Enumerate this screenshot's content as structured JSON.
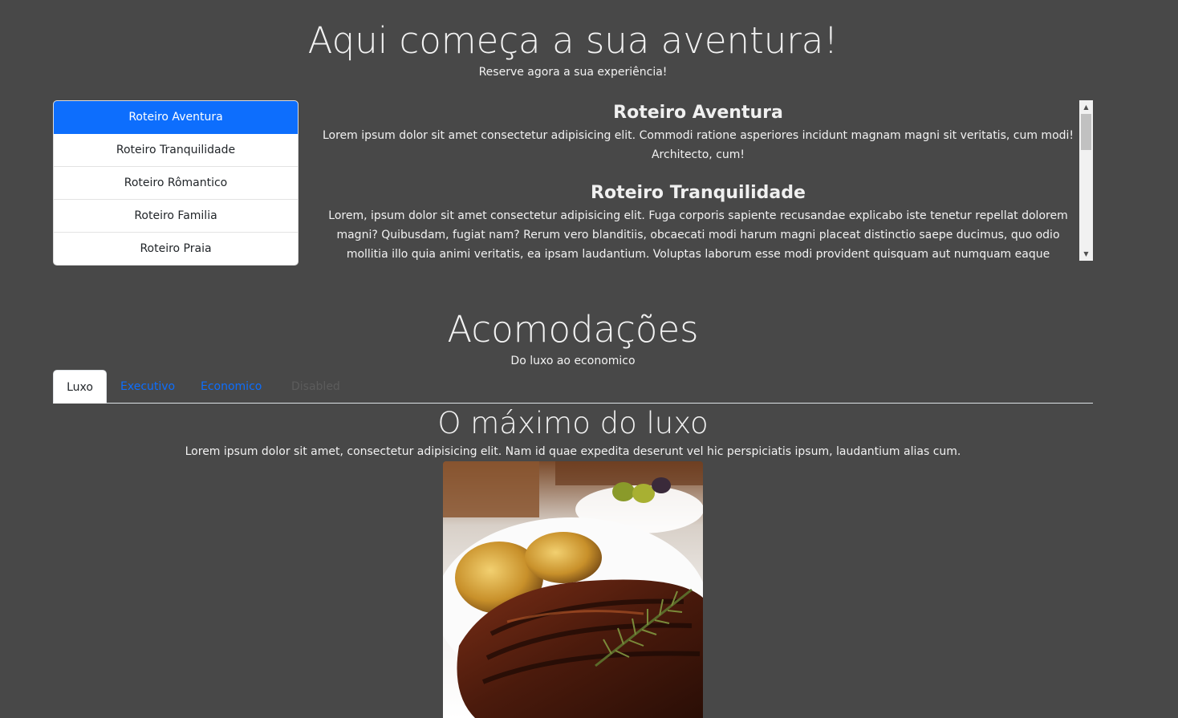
{
  "hero": {
    "title": "Aqui começa a sua aventura!",
    "subtitle": "Reserve agora a sua experiência!"
  },
  "itinerary_list": {
    "items": [
      {
        "label": "Roteiro Aventura"
      },
      {
        "label": "Roteiro Tranquilidade"
      },
      {
        "label": "Roteiro Rômantico"
      },
      {
        "label": "Roteiro Familia"
      },
      {
        "label": "Roteiro Praia"
      }
    ],
    "active_color": "#0d6efd"
  },
  "itinerary_content": {
    "sections": [
      {
        "heading": "Roteiro Aventura",
        "text": "Lorem ipsum dolor sit amet consectetur adipisicing elit. Commodi ratione asperiores incidunt magnam magni sit veritatis, cum modi! Architecto, cum!"
      },
      {
        "heading": "Roteiro Tranquilidade",
        "text": "Lorem, ipsum dolor sit amet consectetur adipisicing elit. Fuga corporis sapiente recusandae explicabo iste tenetur repellat dolorem magni? Quibusdam, fugiat nam? Rerum vero blanditiis, obcaecati modi harum magni placeat distinctio saepe ducimus, quo odio mollitia illo quia animi veritatis, ea ipsam laudantium. Voluptas laborum esse modi provident quisquam aut numquam eaque"
      }
    ]
  },
  "accommodations": {
    "title": "Acomodações",
    "subtitle": "Do luxo ao economico",
    "tabs": [
      {
        "label": "Luxo",
        "state": "active"
      },
      {
        "label": "Executivo",
        "state": "link"
      },
      {
        "label": "Economico",
        "state": "link"
      },
      {
        "label": "Disabled",
        "state": "disabled"
      }
    ],
    "pane": {
      "title": "O máximo do luxo",
      "text": "Lorem ipsum dolor sit amet, consectetur adipisicing elit. Nam id quae expedita deserunt vel hic perspiciatis ipsum, laudantium alias cum."
    }
  },
  "colors": {
    "background": "#484848",
    "link": "#0d6efd",
    "text": "#f2f2f2"
  }
}
